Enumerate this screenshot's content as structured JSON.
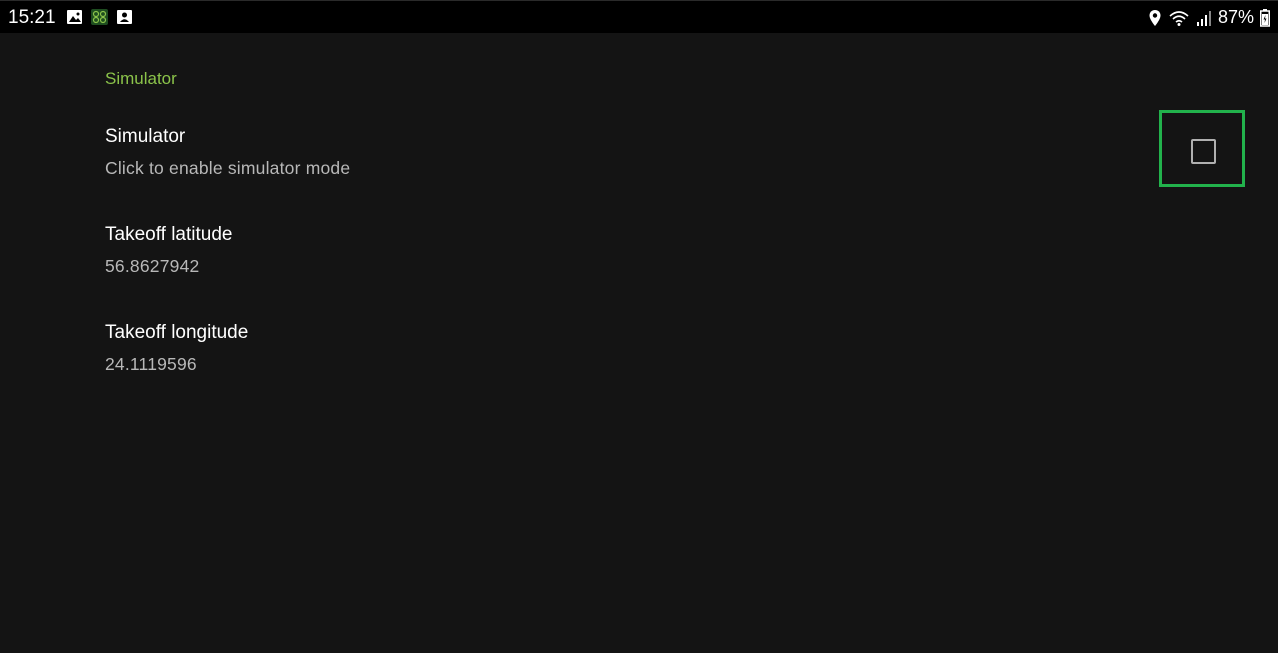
{
  "status_bar": {
    "time": "15:21",
    "left_icons": [
      "image-icon",
      "app-icon",
      "contact-card-icon"
    ],
    "right_icons": [
      "location-pin-icon",
      "wifi-icon",
      "signal-icon"
    ],
    "battery": "87%"
  },
  "preferences": {
    "category": "Simulator",
    "items": [
      {
        "title": "Simulator",
        "summary": "Click to enable simulator mode",
        "checked": false
      },
      {
        "title": "Takeoff latitude",
        "summary": "56.8627942"
      },
      {
        "title": "Takeoff longitude",
        "summary": "24.1119596"
      }
    ]
  },
  "colors": {
    "accent": "#8bc34a",
    "highlight": "#22b24c",
    "background": "#141414"
  }
}
